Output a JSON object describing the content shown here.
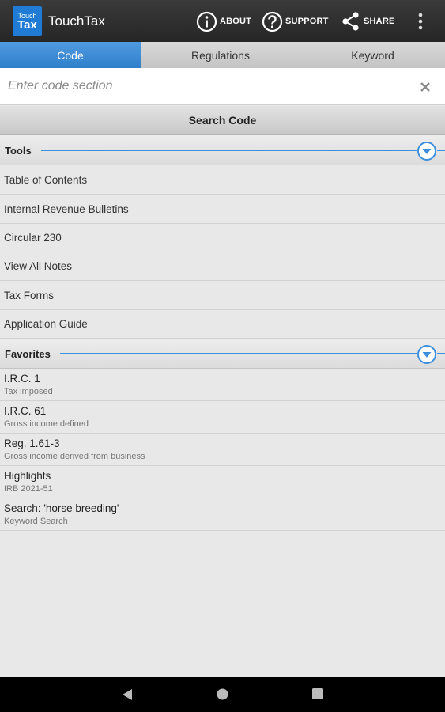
{
  "app": {
    "logo_line1": "Touch",
    "logo_line2": "Tax",
    "title": "TouchTax"
  },
  "actions": {
    "about": "ABOUT",
    "support": "SUPPORT",
    "share": "SHARE"
  },
  "tabs": [
    {
      "label": "Code",
      "active": true
    },
    {
      "label": "Regulations",
      "active": false
    },
    {
      "label": "Keyword",
      "active": false
    }
  ],
  "search": {
    "placeholder": "Enter code section",
    "value": "",
    "button_label": "Search Code"
  },
  "tools": {
    "header": "Tools",
    "items": [
      "Table of Contents",
      "Internal Revenue Bulletins",
      "Circular 230",
      "View All Notes",
      "Tax Forms",
      "Application Guide"
    ]
  },
  "favorites": {
    "header": "Favorites",
    "items": [
      {
        "title": "I.R.C. 1",
        "subtitle": "Tax imposed"
      },
      {
        "title": "I.R.C. 61",
        "subtitle": "Gross income defined"
      },
      {
        "title": "Reg. 1.61-3",
        "subtitle": "Gross income derived from business"
      },
      {
        "title": "Highlights",
        "subtitle": "IRB 2021-51"
      },
      {
        "title": "Search: 'horse breeding'",
        "subtitle": "Keyword Search"
      }
    ]
  },
  "colors": {
    "accent": "#2f7fcb",
    "appbar": "#2e2e2e",
    "divider_line": "#3d8fde"
  },
  "icons": [
    "info-icon",
    "help-icon",
    "share-icon",
    "overflow-menu-icon",
    "close-icon",
    "collapse-arrow-icon",
    "back-icon",
    "home-icon",
    "recents-icon"
  ]
}
